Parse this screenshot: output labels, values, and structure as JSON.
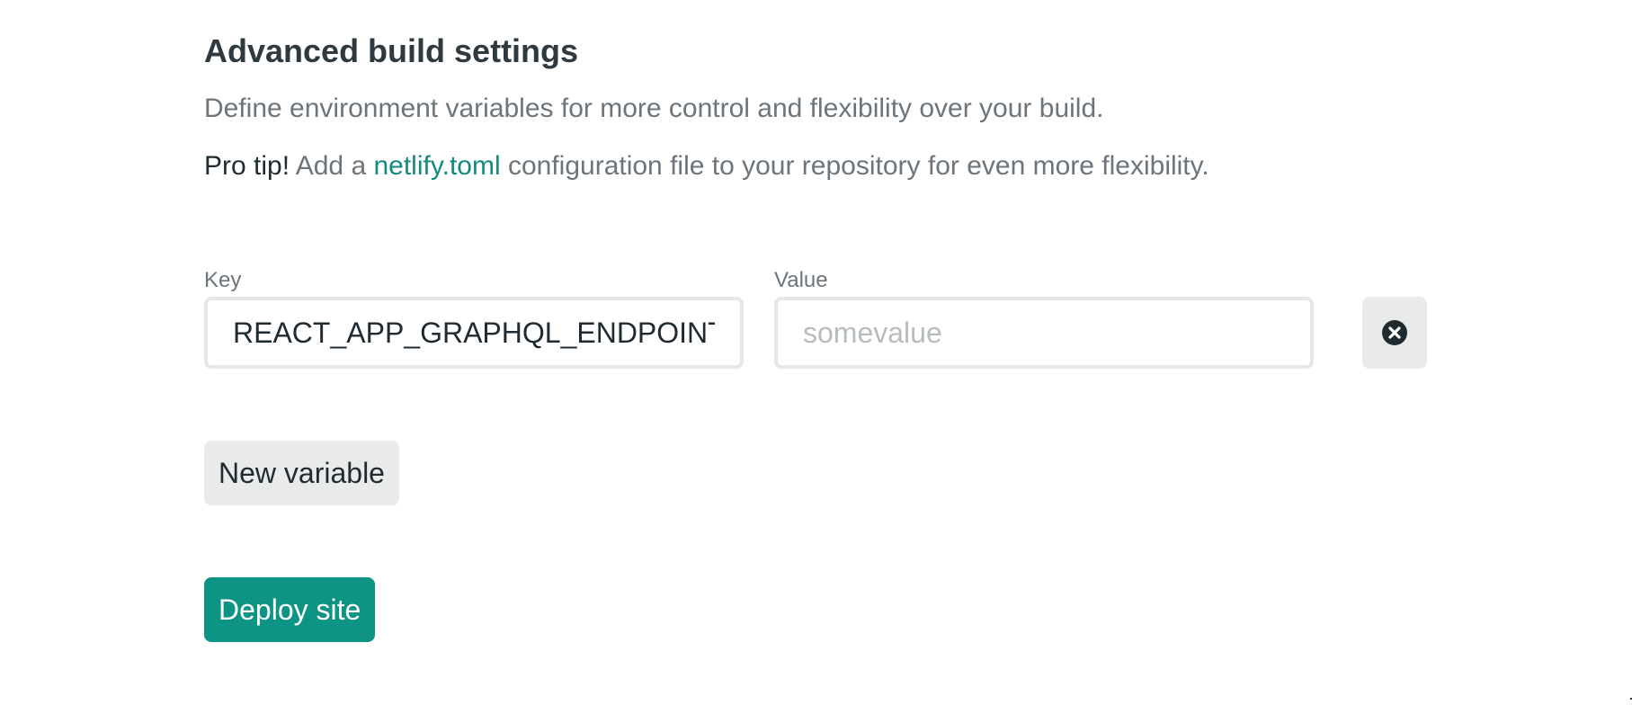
{
  "section": {
    "title": "Advanced build settings",
    "description": "Define environment variables for more control and flexibility over your build.",
    "tip": {
      "prefix": "Pro tip!",
      "before_link": " Add a ",
      "link_text": "netlify.toml",
      "after_link": " configuration file to your repository for even more flexibility."
    }
  },
  "variables": {
    "key_label": "Key",
    "value_label": "Value",
    "rows": [
      {
        "key": "REACT_APP_GRAPHQL_ENDPOINT",
        "value": "",
        "value_placeholder": "somevalue"
      }
    ],
    "delete_icon": "close-circle-icon",
    "new_variable_label": "New variable"
  },
  "actions": {
    "deploy_label": "Deploy site"
  },
  "colors": {
    "accent": "#0e9485",
    "link": "#128a7e",
    "heading": "#2e3a40",
    "muted": "#6c757b",
    "button_gray": "#e9ebeb"
  }
}
